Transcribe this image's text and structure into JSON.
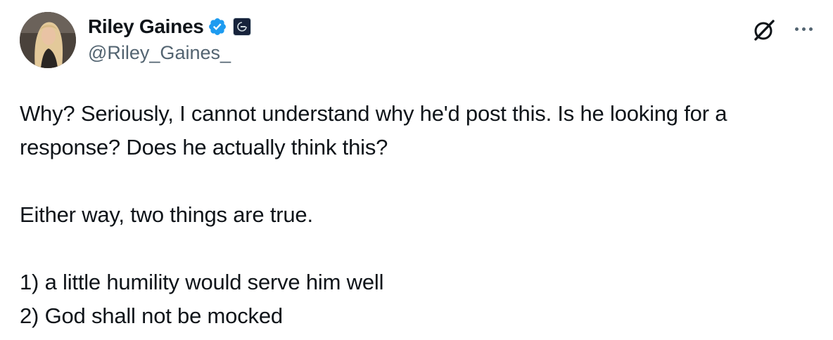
{
  "author": {
    "display_name": "Riley Gaines",
    "handle": "@Riley_Gaines_",
    "verified": true,
    "verified_color": "#1d9bf0",
    "affiliation_badge": "organization-badge-icon"
  },
  "icons": {
    "grok": "grok-icon",
    "more": "more-options-icon"
  },
  "tweet": {
    "paragraphs": [
      "Why? Seriously, I cannot understand why he'd post this. Is he looking for a response? Does he actually think this?",
      "Either way, two things are true.",
      "1) a little humility would serve him well\n2) God shall not be mocked"
    ]
  },
  "colors": {
    "text_primary": "#0f1419",
    "text_secondary": "#536471",
    "background": "#ffffff"
  }
}
